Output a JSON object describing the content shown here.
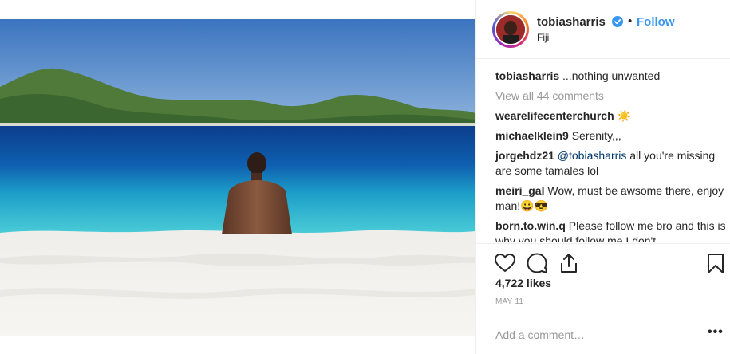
{
  "post": {
    "username": "tobiasharris",
    "follow_label": "Follow",
    "separator": "•",
    "location": "Fiji"
  },
  "comments": {
    "caption_author": "tobiasharris",
    "caption_text": " ...nothing unwanted",
    "view_all": "View all 44 comments",
    "items": [
      {
        "author": "wearelifecenterchurch",
        "text": " ☀️"
      },
      {
        "author": "michaelklein9",
        "text": " Serenity,,,"
      },
      {
        "author": "jorgehdz21",
        "mention": " @tobiasharris",
        "text": " all you're missing are some tamales lol"
      },
      {
        "author": "meiri_gal",
        "text": " Wow, must be awsome there, enjoy man!😀😎"
      },
      {
        "author": "born.to.win.q",
        "text": " Please follow me bro and this is why you should follow me I don't"
      }
    ]
  },
  "actions": {
    "like_icon": "heart-icon",
    "comment_icon": "comment-bubble-icon",
    "share_icon": "share-icon",
    "save_icon": "bookmark-icon"
  },
  "stats": {
    "likes": "4,722 likes",
    "date": "MAY 11"
  },
  "add_comment": {
    "placeholder": "Add a comment…",
    "more_label": "•••"
  },
  "colors": {
    "follow": "#3897f0",
    "secondary_text": "#999999",
    "primary_text": "#262626",
    "border": "#efefef"
  }
}
